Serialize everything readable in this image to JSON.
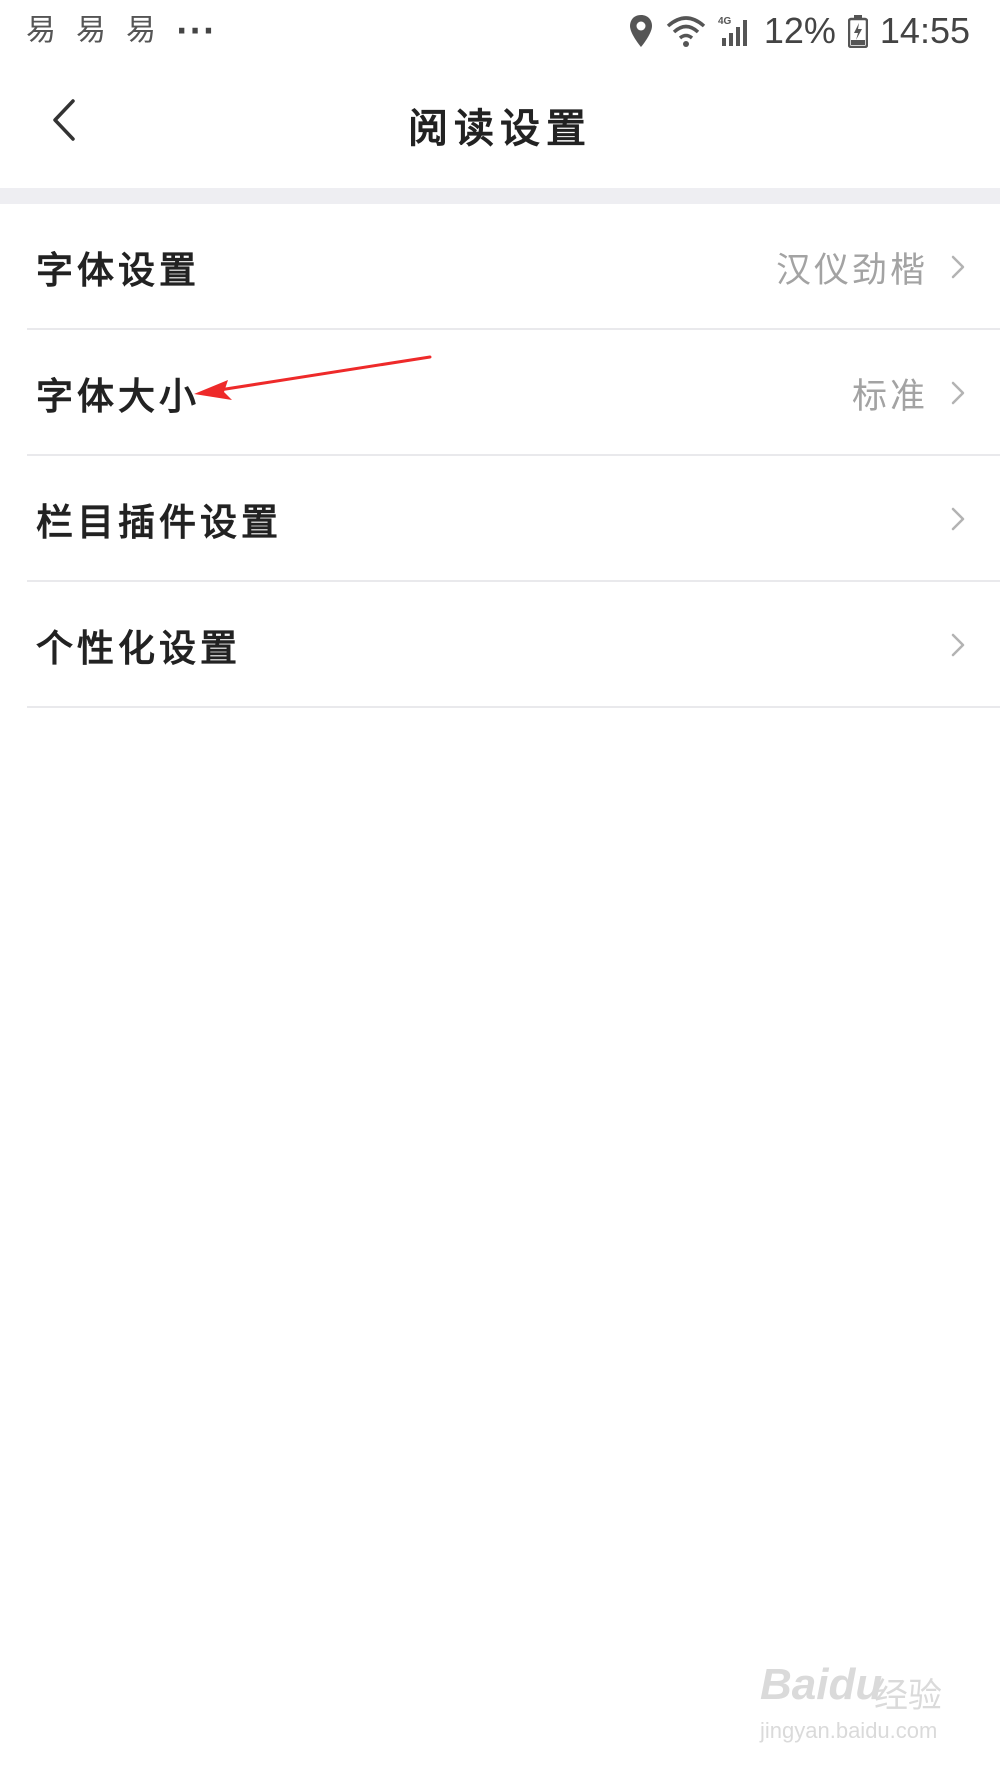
{
  "status_bar": {
    "notification_icons": [
      "易",
      "易",
      "易"
    ],
    "more": "···",
    "battery": "12%",
    "time": "14:55",
    "network": "4G"
  },
  "header": {
    "title": "阅读设置"
  },
  "settings": [
    {
      "label": "字体设置",
      "value": "汉仪劲楷"
    },
    {
      "label": "字体大小",
      "value": "标准"
    },
    {
      "label": "栏目插件设置",
      "value": ""
    },
    {
      "label": "个性化设置",
      "value": ""
    }
  ],
  "watermark": {
    "brand": "Baidu",
    "brand_cn": "经验",
    "url": "jingyan.baidu.com"
  },
  "colors": {
    "annotation_arrow": "#ee2a2a",
    "divider": "#e9e9ec",
    "section_gap": "#eeeef2",
    "value_text": "#a3a3a3"
  }
}
